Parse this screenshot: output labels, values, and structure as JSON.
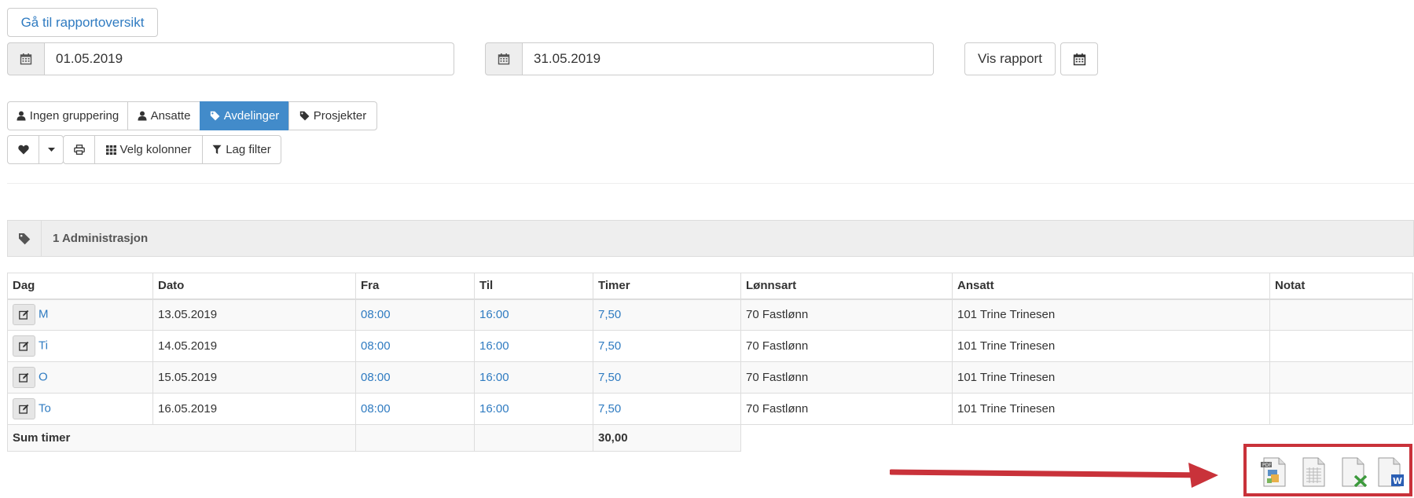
{
  "header": {
    "back_label": "Gå til rapportoversikt"
  },
  "date_range": {
    "from": "01.05.2019",
    "to": "31.05.2019"
  },
  "actions": {
    "vis_rapport": "Vis rapport"
  },
  "grouping": {
    "ingen": "Ingen gruppering",
    "ansatte": "Ansatte",
    "avdelinger": "Avdelinger",
    "prosjekter": "Prosjekter",
    "selected": "avdelinger"
  },
  "toolbar": {
    "velg_kolonner": "Velg kolonner",
    "lag_filter": "Lag filter"
  },
  "group": {
    "title": "1 Administrasjon"
  },
  "table": {
    "columns": [
      "Dag",
      "Dato",
      "Fra",
      "Til",
      "Timer",
      "Lønnsart",
      "Ansatt",
      "Notat"
    ],
    "rows": [
      {
        "dag": "M",
        "dato": "13.05.2019",
        "fra": "08:00",
        "til": "16:00",
        "timer": "7,50",
        "lonnsart": "70 Fastlønn",
        "ansatt": "101 Trine Trinesen",
        "notat": ""
      },
      {
        "dag": "Ti",
        "dato": "14.05.2019",
        "fra": "08:00",
        "til": "16:00",
        "timer": "7,50",
        "lonnsart": "70 Fastlønn",
        "ansatt": "101 Trine Trinesen",
        "notat": ""
      },
      {
        "dag": "O",
        "dato": "15.05.2019",
        "fra": "08:00",
        "til": "16:00",
        "timer": "7,50",
        "lonnsart": "70 Fastlønn",
        "ansatt": "101 Trine Trinesen",
        "notat": ""
      },
      {
        "dag": "To",
        "dato": "16.05.2019",
        "fra": "08:00",
        "til": "16:00",
        "timer": "7,50",
        "lonnsart": "70 Fastlønn",
        "ansatt": "101 Trine Trinesen",
        "notat": ""
      }
    ],
    "sum_label": "Sum timer",
    "sum_value": "30,00"
  },
  "export_icons": [
    "pdf-file-icon",
    "csv-file-icon",
    "excel-file-icon",
    "word-file-icon"
  ],
  "colors": {
    "accent": "#428bca",
    "link": "#2f7bc1",
    "highlight": "#c9323a"
  }
}
